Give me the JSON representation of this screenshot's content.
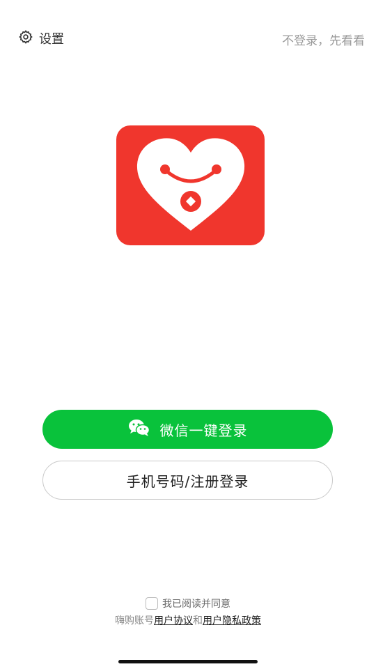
{
  "header": {
    "settings_label": "设置",
    "skip_label": "不登录，先看看"
  },
  "logo": {
    "icon": "heart-smile-logo-icon",
    "background_color": "#f0362d"
  },
  "buttons": {
    "wechat_label": "微信一键登录",
    "wechat_icon": "wechat-icon",
    "wechat_color": "#09c23b",
    "phone_label": "手机号码/注册登录"
  },
  "agreement": {
    "checked": false,
    "text": "我已阅读并同意",
    "prefix": "嗨购账号",
    "user_agreement": "用户协议",
    "conjunction": "和",
    "privacy_policy": "用户隐私政策"
  }
}
